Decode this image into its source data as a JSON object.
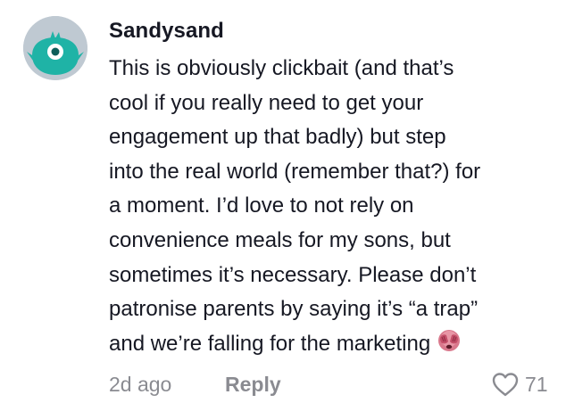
{
  "comment": {
    "username": "Sandysand",
    "lines": [
      "This is obviously clickbait (and that’s",
      "cool if you really need to get your",
      "engagement up that badly) but step",
      "into the real world (remember that?) for",
      "a moment. I’d love to not rely on",
      "convenience meals for my sons, but",
      "sometimes it’s necessary. Please don’t",
      "patronise parents by saying it’s “a trap”",
      "and we’re falling for the marketing"
    ],
    "emoji": "face-with-hands-over-eyes-icon",
    "time": "2d ago",
    "reply_label": "Reply",
    "like_count": "71"
  },
  "colors": {
    "text": "#161823",
    "meta": "#8a8b91",
    "avatar_bg": "#bfc9d2",
    "avatar_creature": "#1fb3a6"
  }
}
